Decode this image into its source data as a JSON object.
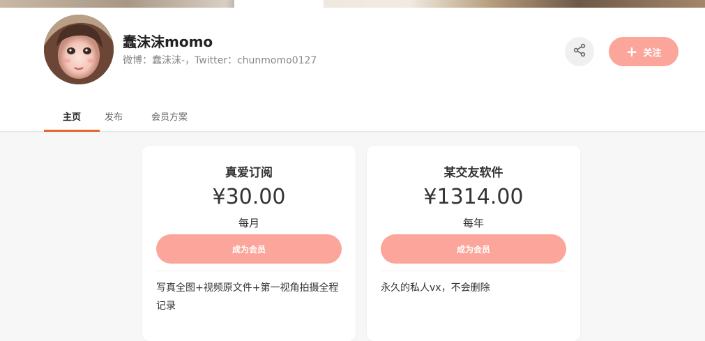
{
  "creator": {
    "name": "蠢沫沫momo",
    "bio": "微博：蠢沫沫-，Twitter：chunmomo0127"
  },
  "actions": {
    "share_icon": "share-icon",
    "follow_icon": "plus-icon",
    "follow_label": "关注"
  },
  "tabs": [
    {
      "label": "主页",
      "active": true
    },
    {
      "label": "发布",
      "active": false
    },
    {
      "label": "会员方案",
      "active": false
    }
  ],
  "plans": [
    {
      "title": "真爱订阅",
      "price": "¥30.00",
      "period": "每月",
      "button": "成为会员",
      "description": "写真全图+视频原文件+第一视角拍摄全程记录"
    },
    {
      "title": "某交友软件",
      "price": "¥1314.00",
      "period": "每年",
      "button": "成为会员",
      "description": "永久的私人vx，不会删除"
    }
  ],
  "colors": {
    "accent_button": "#fba59b",
    "tab_underline": "#e8622e"
  }
}
